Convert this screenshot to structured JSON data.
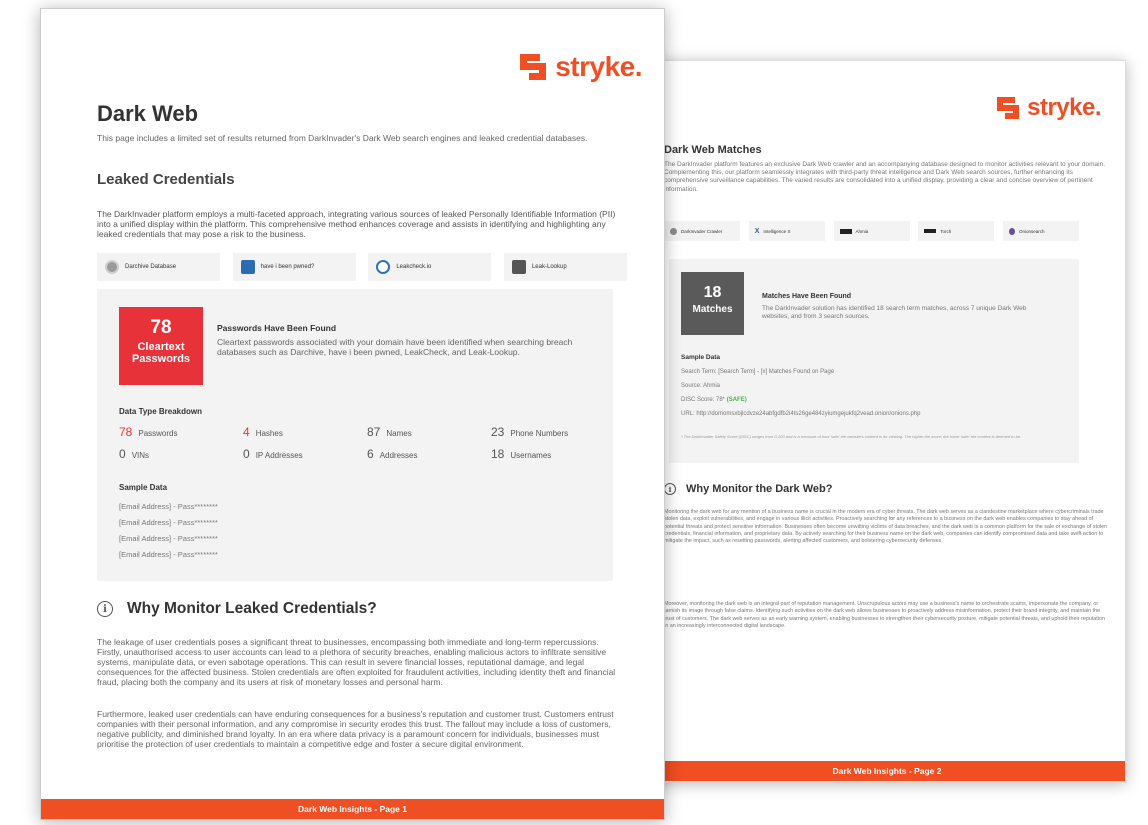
{
  "brand": {
    "name": "stryke.",
    "color": "#f04e23"
  },
  "page1": {
    "title": "Dark Web",
    "intro": "This page includes a limited set of results returned from DarkInvader's Dark Web search engines and leaked credential databases.",
    "section_title": "Leaked Credentials",
    "section_desc": "The DarkInvader platform employs a multi-faceted approach, integrating various sources of leaked Personally Identifiable Information (PII) into a unified display within the platform. This comprehensive method enhances coverage and assists in identifying and highlighting any leaked credentials that may pose a risk to the business.",
    "sources": [
      {
        "label": "Darchive Database",
        "icon": "database-icon",
        "color": "#8a8a8a"
      },
      {
        "label": "have i been pwned?",
        "icon": "hibp-icon",
        "color": "#2b6cb0"
      },
      {
        "label": "Leakcheck.io",
        "icon": "leakcheck-icon",
        "color": "#2f6fbd"
      },
      {
        "label": "Leak-Lookup",
        "icon": "leak-lookup-icon",
        "color": "#555555"
      }
    ],
    "highlight": {
      "count": "78",
      "label": "Cleartext Passwords",
      "title": "Passwords Have Been Found",
      "text": "Cleartext passwords associated with your domain have been identified when searching breach databases such as Darchive, have i been pwned, LeakCheck, and Leak-Lookup."
    },
    "breakdown_title": "Data Type Breakdown",
    "breakdown": [
      {
        "value": "78",
        "label": "Passwords",
        "highlight": true
      },
      {
        "value": "4",
        "label": "Hashes",
        "highlight": true
      },
      {
        "value": "87",
        "label": "Names",
        "highlight": false
      },
      {
        "value": "23",
        "label": "Phone Numbers",
        "highlight": false
      },
      {
        "value": "0",
        "label": "VINs",
        "highlight": false
      },
      {
        "value": "0",
        "label": "IP Addresses",
        "highlight": false
      },
      {
        "value": "6",
        "label": "Addresses",
        "highlight": false
      },
      {
        "value": "18",
        "label": "Usernames",
        "highlight": false
      }
    ],
    "sample_title": "Sample Data",
    "samples": [
      "[Email Address] - Pass********",
      "[Email Address] - Pass********",
      "[Email Address] - Pass********",
      "[Email Address] - Pass********"
    ],
    "why_title": "Why Monitor Leaked Credentials?",
    "why_paragraphs": [
      "The leakage of user credentials poses a significant threat to businesses, encompassing both immediate and long-term repercussions. Firstly, unauthorised access to user accounts can lead to a plethora of security breaches, enabling malicious actors to infiltrate sensitive systems, manipulate data, or even sabotage operations. This can result in severe financial losses, reputational damage, and legal consequences for the affected business. Stolen credentials are often exploited for fraudulent activities, including identity theft and financial fraud, placing both the company and its users at risk of monetary losses and personal harm.",
      "Furthermore, leaked user credentials can have enduring consequences for a business's reputation and customer trust. Customers entrust companies with their personal information, and any compromise in security erodes this trust. The fallout may include a loss of customers, negative publicity, and diminished brand loyalty. In an era where data privacy is a paramount concern for individuals, businesses must prioritise the protection of user credentials to maintain a competitive edge and foster a secure digital environment."
    ],
    "footer": "Dark Web Insights - Page 1"
  },
  "page2": {
    "title": "Dark Web Matches",
    "intro": "The DarkInvader platform features an exclusive Dark Web crawler and an accompanying database designed to monitor activities relevant to your domain. Complementing this, our platform seamlessly integrates with third-party threat intelligence and Dark Web search sources, further enhancing its comprehensive surveillance capabilities. The varied results are consolidated into a unified display, providing a clear and concise overview of pertinent information.",
    "sources": [
      {
        "label": "DarkInvader Crawler",
        "icon": "crawler-icon",
        "color": "#8a8a8a"
      },
      {
        "label": "Intelligence X",
        "icon": "intelx-icon",
        "color": "#3b5998"
      },
      {
        "label": "Ahmia",
        "icon": "ahmia-icon",
        "color": "#222222"
      },
      {
        "label": "Torch",
        "icon": "torch-icon",
        "color": "#222222"
      },
      {
        "label": "Onionsearch",
        "icon": "onion-icon",
        "color": "#6a4c9c"
      }
    ],
    "highlight": {
      "count": "18",
      "label": "Matches",
      "title": "Matches Have Been Found",
      "text": "The DarkInvader solution has identified 18 search term matches, across 7 unique Dark Web websites, and from 3 search sources."
    },
    "sample_title": "Sample Data",
    "sample_lines": {
      "term": "Search Term: [Search Term] - [x] Matches Found on Page",
      "source": "Source: Ahmia",
      "disc_prefix": "DISC Score: 78*",
      "disc_status": "(SAFE)",
      "url": "URL: http://domomsxbjlcdvze24abfgdfb2i4ts26ge484zyiumgejukfq2vead.onion/onions.php"
    },
    "footnote": "* The DarkInvader Safety Score (DISC) ranges from 0-100 and is a measure of how 'safe' the website's content is for viewing. The higher the score, the lower 'safe' the content is deemed to be.",
    "why_title": "Why Monitor the Dark Web?",
    "why_paragraphs": [
      "Monitoring the dark web for any mention of a business name is crucial in the modern era of cyber threats. The dark web serves as a clandestine marketplace where cybercriminals trade stolen data, exploit vulnerabilities, and engage in various illicit activities. Proactively searching for any references to a business on the dark web enables companies to stay ahead of potential threats and protect sensitive information. Businesses often become unwitting victims of data breaches, and the dark web is a common platform for the sale or exchange of stolen credentials, financial information, and proprietary data. By actively searching for their business name on the dark web, companies can identify compromised data and take swift action to mitigate the impact, such as resetting passwords, alerting affected customers, and bolstering cybersecurity defenses.",
      "Moreover, monitoring the dark web is an integral part of reputation management. Unscrupulous actors may use a business's name to orchestrate scams, impersonate the company, or tarnish its image through false claims. Identifying such activities on the dark web allows businesses to proactively address misinformation, protect their brand integrity, and maintain the trust of customers. The dark web serves as an early warning system, enabling businesses to strengthen their cybersecurity posture, mitigate potential threats, and uphold their reputation in an increasingly interconnected digital landscape."
    ],
    "footer": "Dark Web Insights - Page 2"
  }
}
